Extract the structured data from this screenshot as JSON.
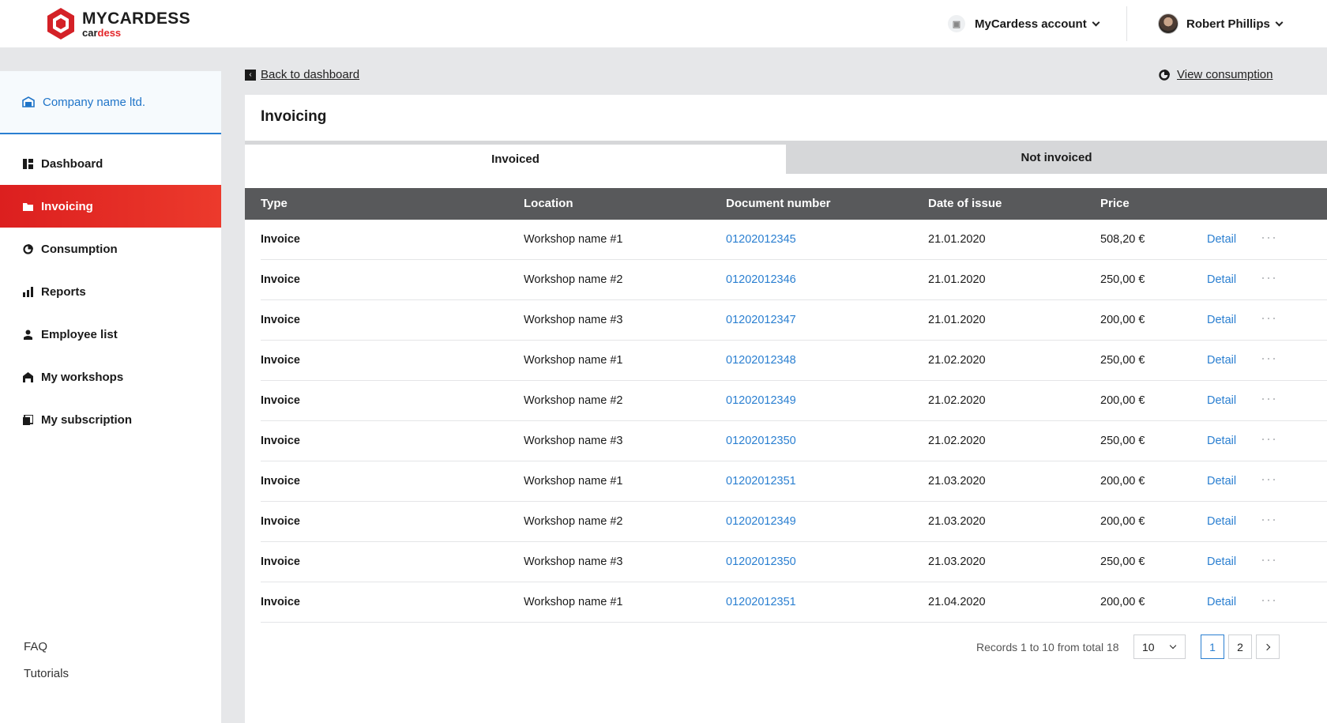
{
  "header": {
    "brand": "MYCARDESS",
    "brand_sub_a": "car",
    "brand_sub_b": "dess",
    "account_label": "MyCardess account",
    "user_name": "Robert Phillips"
  },
  "sidebar": {
    "company": "Company name ltd.",
    "items": [
      {
        "label": "Dashboard",
        "icon": "dashboard-icon"
      },
      {
        "label": "Invoicing",
        "icon": "folder-icon",
        "active": true
      },
      {
        "label": "Consumption",
        "icon": "pie-icon"
      },
      {
        "label": "Reports",
        "icon": "bar-chart-icon"
      },
      {
        "label": "Employee list",
        "icon": "person-icon"
      },
      {
        "label": "My workshops",
        "icon": "workshop-icon"
      },
      {
        "label": "My subscription",
        "icon": "document-icon"
      }
    ],
    "footer": [
      "FAQ",
      "Tutorials"
    ]
  },
  "links": {
    "back": "Back to dashboard",
    "consumption": "View consumption"
  },
  "page": {
    "title": "Invoicing",
    "tabs": [
      "Invoiced",
      "Not invoiced"
    ]
  },
  "table": {
    "columns": [
      "Type",
      "Location",
      "Document number",
      "Date of issue",
      "Price"
    ],
    "rows": [
      {
        "type": "Invoice",
        "location": "Workshop name #1",
        "doc": "01202012345",
        "date": "21.01.2020",
        "price": "508,20 €",
        "action": "Detail"
      },
      {
        "type": "Invoice",
        "location": "Workshop name #2",
        "doc": "01202012346",
        "date": "21.01.2020",
        "price": "250,00 €",
        "action": "Detail"
      },
      {
        "type": "Invoice",
        "location": "Workshop name #3",
        "doc": "01202012347",
        "date": "21.01.2020",
        "price": "200,00 €",
        "action": "Detail"
      },
      {
        "type": "Invoice",
        "location": "Workshop name #1",
        "doc": "01202012348",
        "date": "21.02.2020",
        "price": "250,00 €",
        "action": "Detail"
      },
      {
        "type": "Invoice",
        "location": "Workshop name #2",
        "doc": "01202012349",
        "date": "21.02.2020",
        "price": "200,00 €",
        "action": "Detail"
      },
      {
        "type": "Invoice",
        "location": "Workshop name #3",
        "doc": "01202012350",
        "date": "21.02.2020",
        "price": "250,00 €",
        "action": "Detail"
      },
      {
        "type": "Invoice",
        "location": "Workshop name #1",
        "doc": "01202012351",
        "date": "21.03.2020",
        "price": "200,00 €",
        "action": "Detail"
      },
      {
        "type": "Invoice",
        "location": "Workshop name #2",
        "doc": "01202012349",
        "date": "21.03.2020",
        "price": "200,00 €",
        "action": "Detail"
      },
      {
        "type": "Invoice",
        "location": "Workshop name #3",
        "doc": "01202012350",
        "date": "21.03.2020",
        "price": "250,00 €",
        "action": "Detail"
      },
      {
        "type": "Invoice",
        "location": "Workshop name #1",
        "doc": "01202012351",
        "date": "21.04.2020",
        "price": "200,00 €",
        "action": "Detail"
      }
    ],
    "more": "···"
  },
  "pagination": {
    "records": "Records 1 to 10 from total 18",
    "per_page": "10",
    "pages": [
      "1",
      "2"
    ],
    "current": "1"
  },
  "colors": {
    "accent_red": "#e3262a",
    "link_blue": "#2a7fd1",
    "header_gray": "#58595b"
  }
}
